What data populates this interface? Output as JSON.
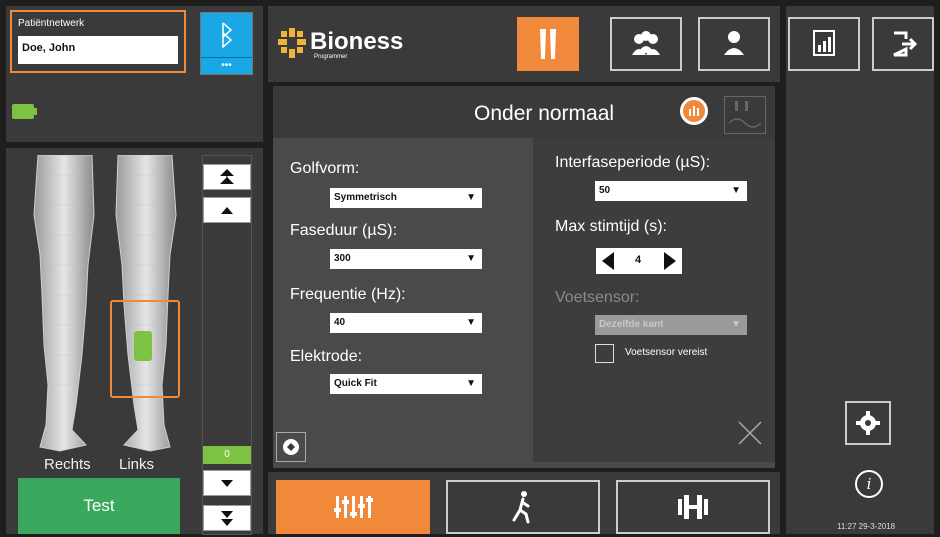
{
  "patient": {
    "network_label": "Patiëntnetwerk",
    "name": "Doe, John"
  },
  "bluetooth": {
    "icon": "bluetooth-icon",
    "dots": "•••"
  },
  "battery": {
    "icon": "battery-icon",
    "color": "#7dc242"
  },
  "legs": {
    "right_label": "Rechts",
    "left_label": "Links",
    "electrode_color": "#7dc242",
    "highlight_color": "#f0893a"
  },
  "intensity": {
    "value": "0"
  },
  "test_button": "Test",
  "logo": {
    "name": "Bioness",
    "sub": "Programmer"
  },
  "header_buttons": [
    {
      "icon": "legs-icon",
      "active": true
    },
    {
      "icon": "group-icon",
      "active": false
    },
    {
      "icon": "person-icon",
      "active": false
    }
  ],
  "right_buttons": [
    {
      "icon": "report-chart-icon"
    },
    {
      "icon": "exit-icon"
    }
  ],
  "main": {
    "title": "Onder normaal",
    "fields_left": [
      {
        "label": "Golfvorm:",
        "value": "Symmetrisch"
      },
      {
        "label": "Faseduur (µS):",
        "value": "300"
      },
      {
        "label": "Frequentie (Hz):",
        "value": "40"
      },
      {
        "label": "Elektrode:",
        "value": "Quick Fit"
      }
    ],
    "interphase": {
      "label": "Interfaseperiode (µS):",
      "value": "50"
    },
    "max_stim": {
      "label": "Max stimtijd (s):",
      "value": "4"
    },
    "foot_sensor": {
      "label": "Voetsensor:",
      "value": "Dezelfde kant"
    },
    "foot_sensor_required": {
      "label": "Voetsensor vereist",
      "checked": false
    }
  },
  "bottom_tabs": [
    {
      "icon": "sliders-icon",
      "active": true
    },
    {
      "icon": "walking-icon",
      "active": false
    },
    {
      "icon": "dumbbell-icon",
      "active": false
    }
  ],
  "status": {
    "datetime": "11:27 29-3-2018"
  },
  "colors": {
    "accent": "#f0893a",
    "bluetooth": "#1aa7e6",
    "test_green": "#3aa85c"
  }
}
